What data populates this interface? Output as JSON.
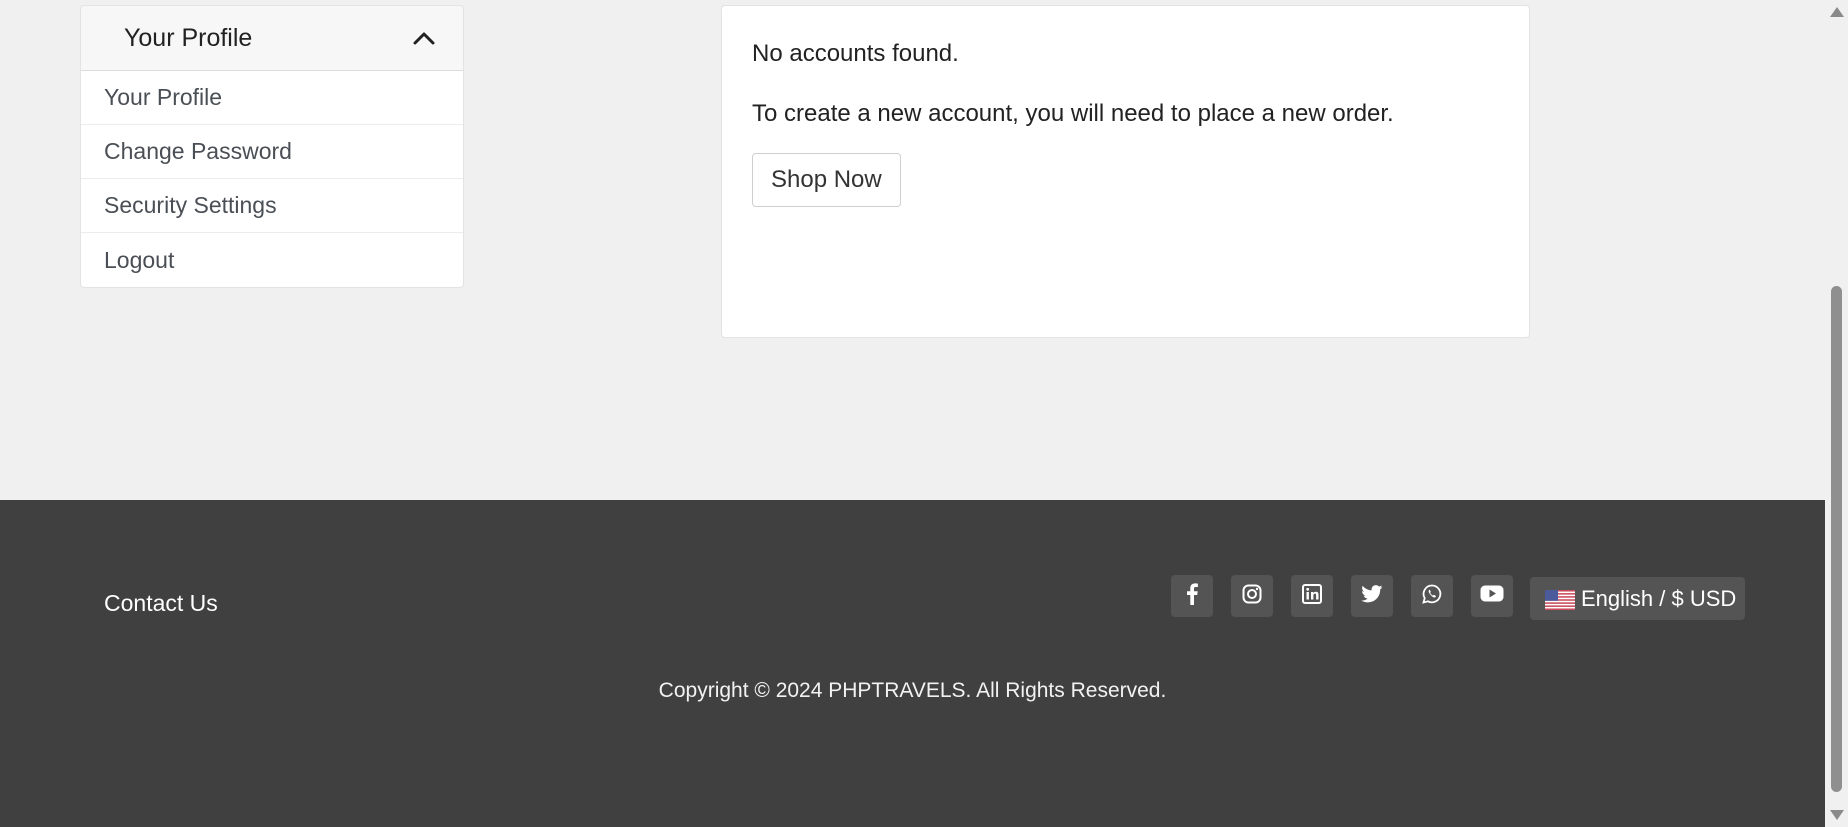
{
  "sidebar": {
    "header_title": "Your Profile",
    "items": [
      {
        "label": "Your Profile"
      },
      {
        "label": "Change Password"
      },
      {
        "label": "Security Settings"
      },
      {
        "label": "Logout"
      }
    ]
  },
  "main": {
    "empty_message": "No accounts found.",
    "help_message": "To create a new account, you will need to place a new order.",
    "shop_button_label": "Shop Now"
  },
  "footer": {
    "contact_label": "Contact Us",
    "social_icons": [
      "facebook-icon",
      "instagram-icon",
      "linkedin-icon",
      "twitter-icon",
      "whatsapp-icon",
      "youtube-icon"
    ],
    "language_currency": "English / $ USD",
    "copyright": "Copyright © 2024 PHPTRAVELS. All Rights Reserved."
  },
  "colors": {
    "page_bg": "#f0f0f0",
    "footer_bg": "#404040",
    "social_btn_bg": "#545454"
  }
}
